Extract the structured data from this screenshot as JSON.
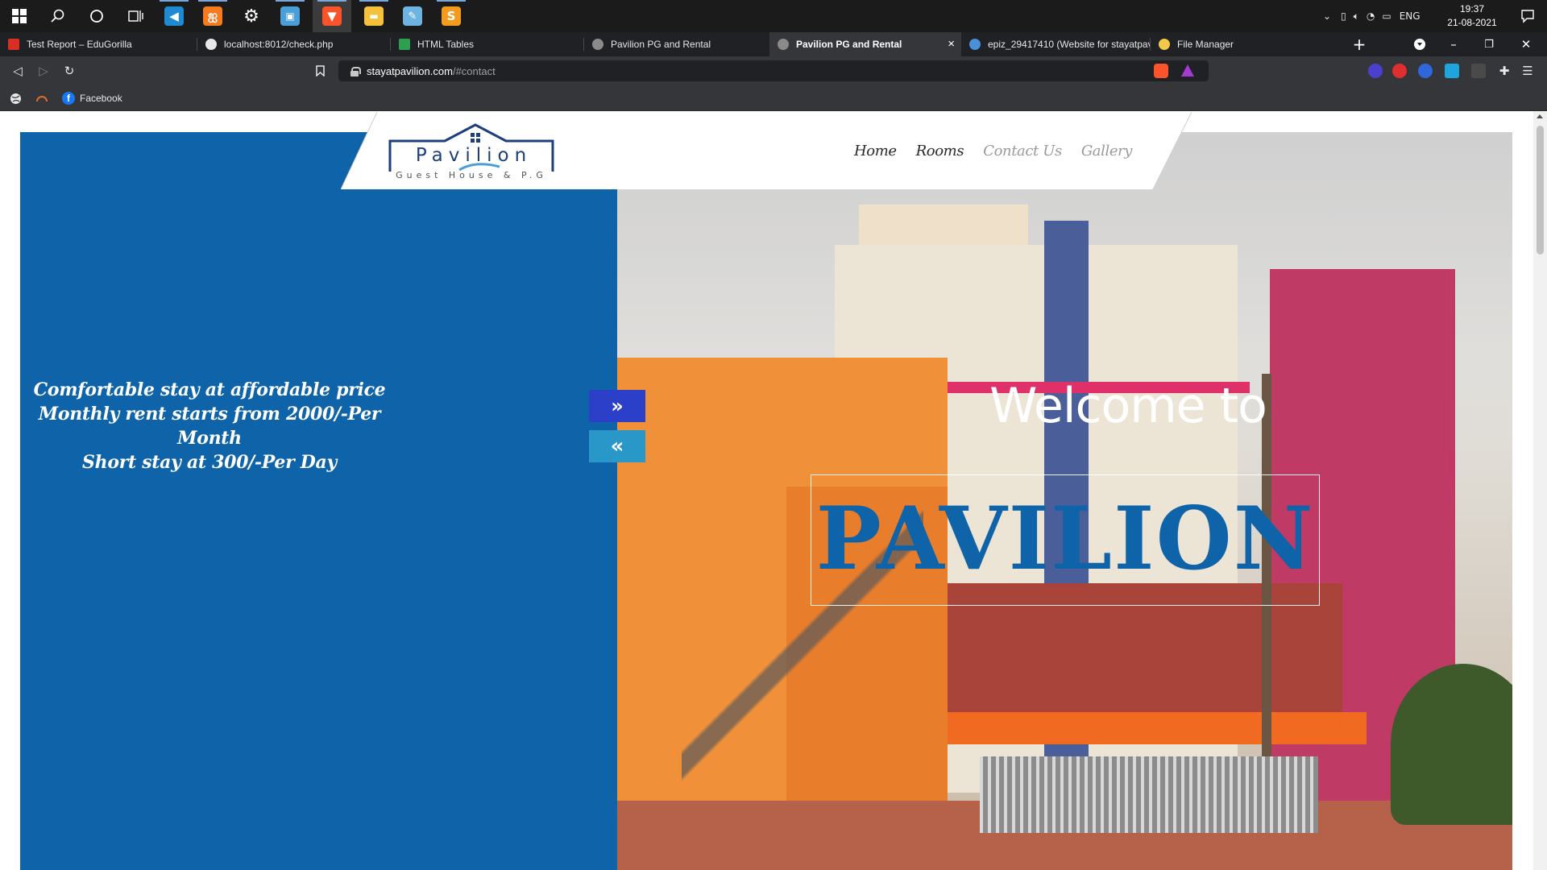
{
  "taskbar": {
    "apps": [
      "start",
      "search",
      "cortana",
      "task-view",
      "vscode",
      "xampp",
      "settings",
      "remote-desktop",
      "brave",
      "file-explorer",
      "notepad",
      "sublime"
    ],
    "tray": {
      "language": "ENG",
      "time": "19:37",
      "date": "21-08-2021"
    }
  },
  "browser": {
    "tabs": [
      {
        "title": "Test Report – EduGorilla",
        "favicon_color": "#d93025"
      },
      {
        "title": "localhost:8012/check.php",
        "favicon_color": "#e8e8e8"
      },
      {
        "title": "HTML Tables",
        "favicon_color": "#2e9e4f"
      },
      {
        "title": "Pavilion PG and Rental",
        "favicon_color": "#8a8a8a"
      },
      {
        "title": "Pavilion PG and Rental",
        "favicon_color": "#8a8a8a"
      },
      {
        "title": "epiz_29417410 (Website for stayatpav",
        "favicon_color": "#4a90d9"
      },
      {
        "title": "File Manager",
        "favicon_color": "#f2c84b"
      }
    ],
    "url": {
      "host": "stayatpavilion.com",
      "path": "/#contact"
    },
    "bookmarks": [
      {
        "label": "Facebook"
      }
    ]
  },
  "site": {
    "tagline": [
      "Comfortable stay at affordable price",
      "Monthly rent starts from 2000/-Per Month",
      "Short stay at 300/-Per Day"
    ],
    "logo": {
      "word": "Pavilion",
      "subtitle": "Guest House & P.G"
    },
    "nav": [
      "Home",
      "Rooms",
      "Contact Us",
      "Gallery"
    ],
    "hero": {
      "welcome": "Welcome to",
      "brand": "PAVILION"
    },
    "arrows": {
      "next": "»",
      "prev": "«"
    },
    "colors": {
      "primary": "#0f63a8",
      "next_button": "#2b3fc8",
      "prev_button": "#2a97c9"
    }
  }
}
